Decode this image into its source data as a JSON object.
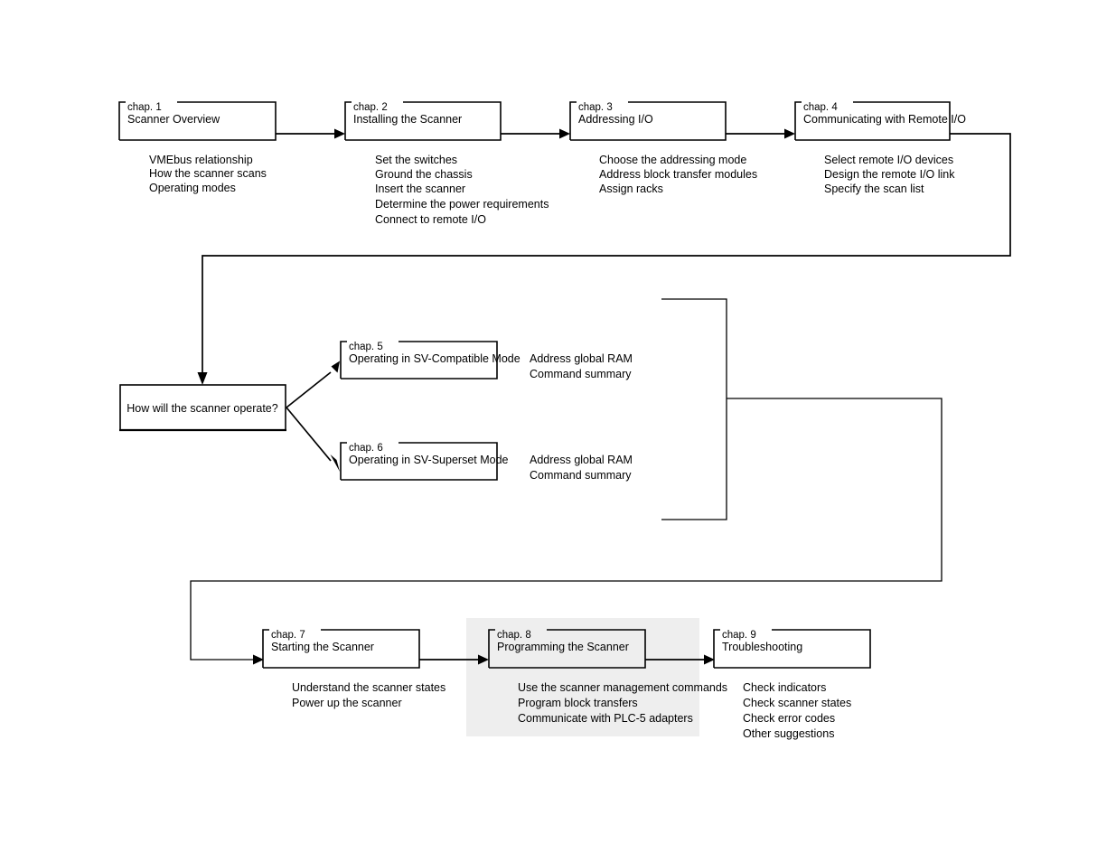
{
  "diagram": {
    "title": "Scanner Manual Chapter Roadmap",
    "background_color": "#ffffff",
    "line_color": "#000000",
    "highlight_color": "#eeeeee"
  },
  "chapters": [
    {
      "id": "chap1",
      "label": "chap. 1",
      "title": "Scanner Overview",
      "bullets": [
        "VMEbus relationship",
        "How the scanner scans",
        "Operating modes"
      ]
    },
    {
      "id": "chap2",
      "label": "chap. 2",
      "title": "Installing the Scanner",
      "bullets": [
        "Set the switches",
        "Ground the chassis",
        "Insert the scanner",
        "Determine the power requirements",
        "Connect to remote I/O"
      ]
    },
    {
      "id": "chap3",
      "label": "chap. 3",
      "title": "Addressing I/O",
      "bullets": [
        "Choose the addressing mode",
        "Address block transfer modules",
        "Assign racks"
      ]
    },
    {
      "id": "chap4",
      "label": "chap. 4",
      "title": "Communicating with Remote I/O",
      "bullets": [
        "Select remote I/O devices",
        "Design the remote I/O link",
        "Specify the scan list"
      ]
    },
    {
      "id": "chap5",
      "label": "chap. 5",
      "title": "Operating in SV-Compatible Mode",
      "bullets": [
        "Address global RAM",
        "Command summary"
      ]
    },
    {
      "id": "chap6",
      "label": "chap. 6",
      "title": "Operating in SV-Superset Mode",
      "bullets": [
        "Address global RAM",
        "Command summary"
      ]
    },
    {
      "id": "chap7",
      "label": "chap. 7",
      "title": "Starting the Scanner",
      "bullets": [
        "Understand the scanner states",
        "Power up the scanner"
      ]
    },
    {
      "id": "chap8",
      "label": "chap. 8",
      "title": "Programming the Scanner",
      "bullets": [
        "Use the scanner management commands",
        "Program block transfers",
        "Communicate with PLC-5 adapters"
      ]
    },
    {
      "id": "chap9",
      "label": "chap. 9",
      "title": "Troubleshooting",
      "bullets": [
        "Check indicators",
        "Check scanner states",
        "Check error codes",
        "Other suggestions"
      ]
    }
  ],
  "decision": {
    "id": "decision1",
    "text": "How will the scanner operate?"
  }
}
